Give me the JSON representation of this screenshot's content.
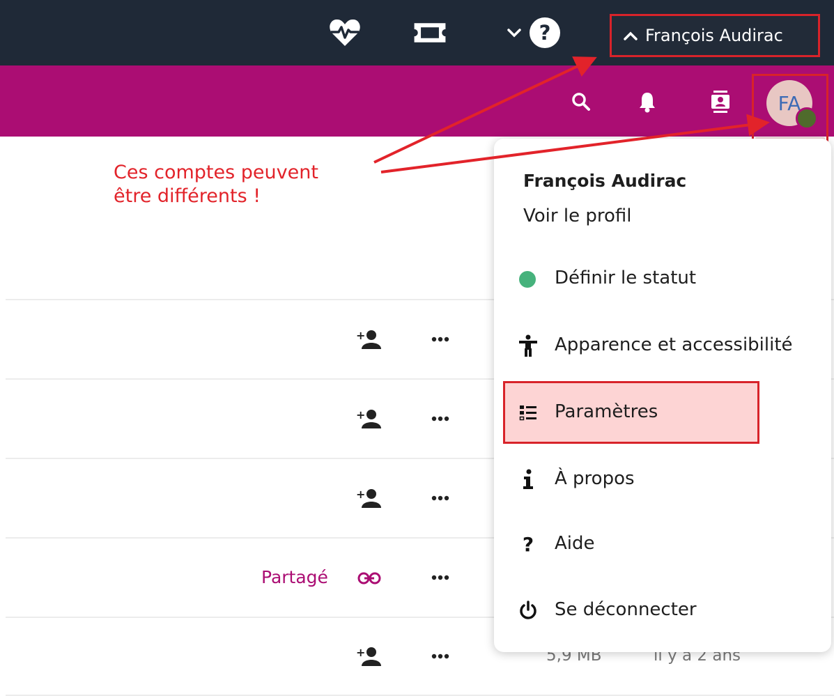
{
  "admin_bar": {
    "user_label": "François Audirac",
    "icons": [
      "heartbeat-icon",
      "ticket-icon",
      "chevron-down-icon",
      "question-circle-icon",
      "chevron-up-icon"
    ]
  },
  "header": {
    "avatar_initials": "FA"
  },
  "annotation": {
    "text": "Ces comptes peuvent\nêtre différents !",
    "color": "#e2232a"
  },
  "file_list": {
    "shared_label": "Partagé",
    "last_row_size": "5,9 MB",
    "last_row_date": "il y a 2 ans"
  },
  "account_menu": {
    "user_name": "François Audirac",
    "view_profile": "Voir le profil",
    "items": [
      {
        "label": "Définir le statut",
        "icon": "status-dot-icon"
      },
      {
        "label": "Apparence et accessibilité",
        "icon": "accessibility-icon"
      },
      {
        "label": "Paramètres",
        "icon": "settings-list-icon"
      },
      {
        "label": "À propos",
        "icon": "info-icon"
      },
      {
        "label": "Aide",
        "icon": "question-icon"
      },
      {
        "label": "Se déconnecter",
        "icon": "power-icon"
      }
    ]
  },
  "colors": {
    "admin_bar": "#1f2937",
    "header": "#ab0d73",
    "accent": "#ab0d73",
    "highlight_border": "#d8232a",
    "status_online": "#46b27c"
  }
}
